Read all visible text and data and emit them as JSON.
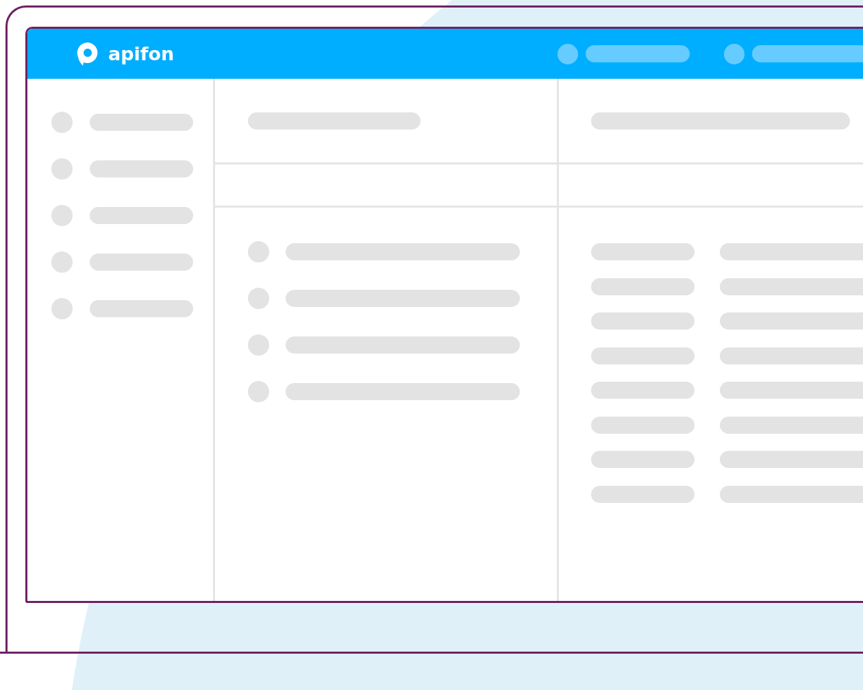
{
  "header": {
    "logo_text": "apifon"
  }
}
